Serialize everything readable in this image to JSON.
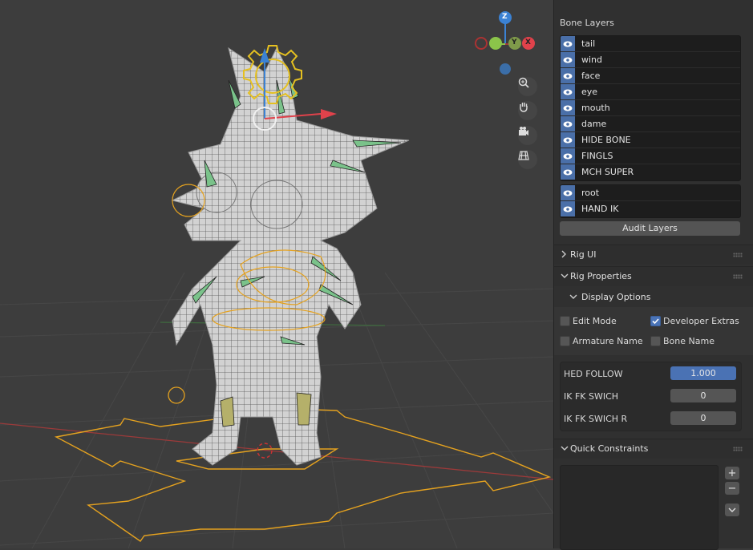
{
  "bone_layers": {
    "title": "Bone Layers",
    "group1": [
      "tail",
      "wind",
      "face",
      "eye",
      "mouth",
      "dame",
      "HIDE BONE",
      "FINGLS",
      "MCH SUPER"
    ],
    "group2": [
      "root",
      "HAND IK"
    ],
    "audit_button": "Audit Layers"
  },
  "sections": {
    "rig_ui": "Rig UI",
    "rig_properties": "Rig Properties",
    "display_options": "Display Options",
    "quick_constraints": "Quick Constraints"
  },
  "display_options": {
    "edit_mode": {
      "label": "Edit Mode",
      "checked": false
    },
    "developer_extras": {
      "label": "Developer Extras",
      "checked": true
    },
    "armature_name": {
      "label": "Armature Name",
      "checked": false
    },
    "bone_name": {
      "label": "Bone Name",
      "checked": false
    }
  },
  "properties": [
    {
      "label": "HED FOLLOW",
      "value": "1.000"
    },
    {
      "label": "IK FK SWICH",
      "value": "0"
    },
    {
      "label": "IK FK SWICH R",
      "value": "0"
    }
  ],
  "gizmo": {
    "z": "Z",
    "y": "Y",
    "x": "X"
  },
  "colors": {
    "accent": "#4a72b4",
    "x_axis": "#e0424b",
    "y_axis": "#8bc44a",
    "z_axis": "#3b82d4",
    "bone_select": "#e5a21f"
  }
}
